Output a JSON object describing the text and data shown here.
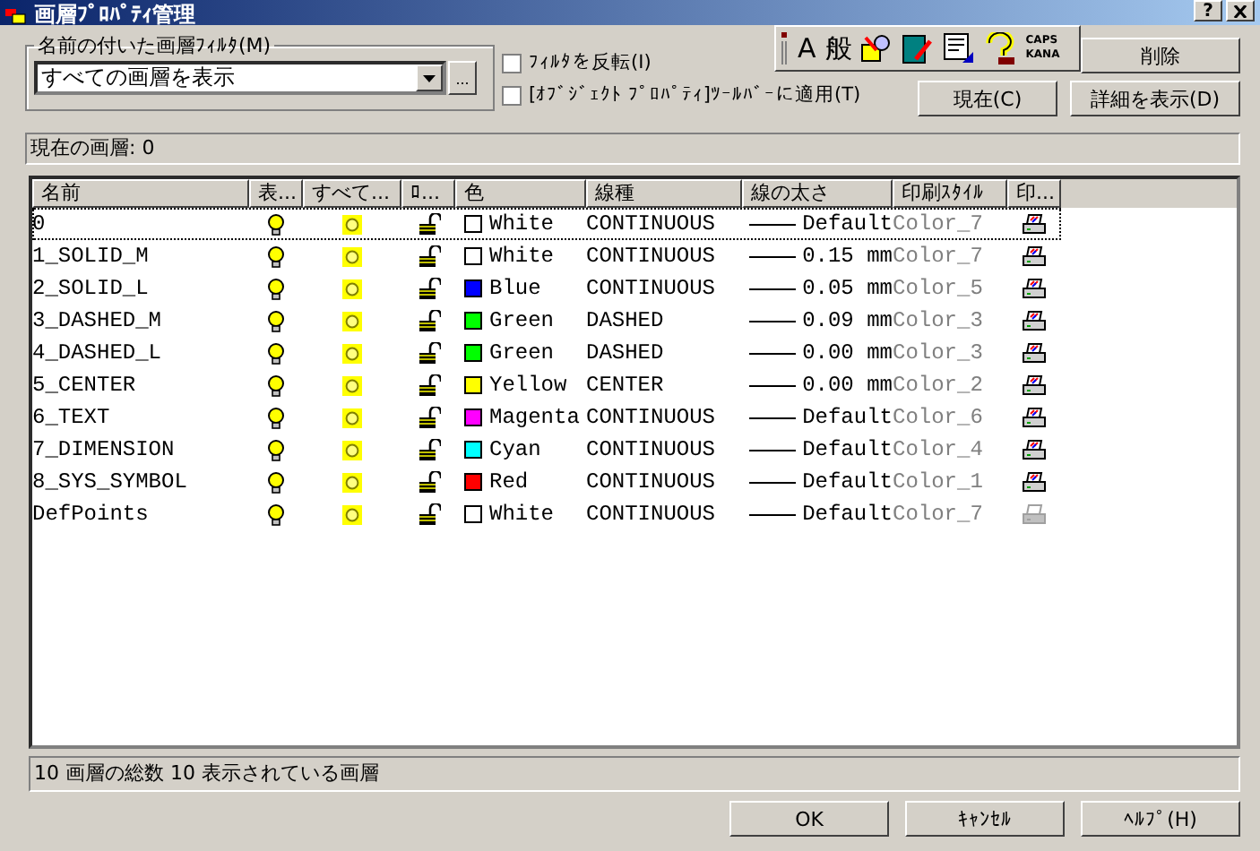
{
  "window": {
    "title": "画層ﾌﾟﾛﾊﾟﾃｨ管理",
    "help": "?"
  },
  "filter": {
    "legend": "名前の付いた画層ﾌｨﾙﾀ(M)",
    "value": "すべての画層を表示",
    "browse": "..."
  },
  "options": [
    {
      "label": "ﾌｨﾙﾀを反転(I)",
      "checked": false
    },
    {
      "label": "[ｵﾌﾞｼﾞｪｸﾄ ﾌﾟﾛﾊﾟﾃｨ]ﾂｰﾙﾊﾞｰに適用(T)",
      "checked": false
    }
  ],
  "ime_toolbar": {
    "glyphs": [
      "A",
      "般"
    ],
    "caps": "CAPS",
    "kana": "KANA"
  },
  "delete_button": "削除",
  "current_button": "現在(C)",
  "details_button": "詳細を表示(D)",
  "current_layer": "現在の画層:  0",
  "table": {
    "columns": [
      "名前",
      "表...",
      "すべて...",
      "ﾛ...",
      "色",
      "線種",
      "線の太さ",
      "印刷ｽﾀｲﾙ",
      "印..."
    ],
    "rows": [
      {
        "name": "0",
        "on": true,
        "frozen": false,
        "locked": false,
        "color": "#ffffff",
        "color_name": "White",
        "linetype": "CONTINUOUS",
        "lineweight": "Default",
        "plot_style": "Color_7",
        "plot": true,
        "selected": true
      },
      {
        "name": "1_SOLID_M",
        "on": true,
        "frozen": false,
        "locked": false,
        "color": "#ffffff",
        "color_name": "White",
        "linetype": "CONTINUOUS",
        "lineweight": "0.15 mm",
        "plot_style": "Color_7",
        "plot": true,
        "selected": false
      },
      {
        "name": "2_SOLID_L",
        "on": true,
        "frozen": false,
        "locked": false,
        "color": "#0000ff",
        "color_name": "Blue",
        "linetype": "CONTINUOUS",
        "lineweight": "0.05 mm",
        "plot_style": "Color_5",
        "plot": true,
        "selected": false
      },
      {
        "name": "3_DASHED_M",
        "on": true,
        "frozen": false,
        "locked": false,
        "color": "#00ff00",
        "color_name": "Green",
        "linetype": "DASHED",
        "lineweight": "0.09 mm",
        "plot_style": "Color_3",
        "plot": true,
        "selected": false
      },
      {
        "name": "4_DASHED_L",
        "on": true,
        "frozen": false,
        "locked": false,
        "color": "#00ff00",
        "color_name": "Green",
        "linetype": "DASHED",
        "lineweight": "0.00 mm",
        "plot_style": "Color_3",
        "plot": true,
        "selected": false
      },
      {
        "name": "5_CENTER",
        "on": true,
        "frozen": false,
        "locked": false,
        "color": "#ffff00",
        "color_name": "Yellow",
        "linetype": "CENTER",
        "lineweight": "0.00 mm",
        "plot_style": "Color_2",
        "plot": true,
        "selected": false
      },
      {
        "name": "6_TEXT",
        "on": true,
        "frozen": false,
        "locked": false,
        "color": "#ff00ff",
        "color_name": "Magenta",
        "linetype": "CONTINUOUS",
        "lineweight": "Default",
        "plot_style": "Color_6",
        "plot": true,
        "selected": false
      },
      {
        "name": "7_DIMENSION",
        "on": true,
        "frozen": false,
        "locked": false,
        "color": "#00ffff",
        "color_name": "Cyan",
        "linetype": "CONTINUOUS",
        "lineweight": "Default",
        "plot_style": "Color_4",
        "plot": true,
        "selected": false
      },
      {
        "name": "8_SYS_SYMBOL",
        "on": true,
        "frozen": false,
        "locked": false,
        "color": "#ff0000",
        "color_name": "Red",
        "linetype": "CONTINUOUS",
        "lineweight": "Default",
        "plot_style": "Color_1",
        "plot": true,
        "selected": false
      },
      {
        "name": "DefPoints",
        "on": true,
        "frozen": false,
        "locked": false,
        "color": "#ffffff",
        "color_name": "White",
        "linetype": "CONTINUOUS",
        "lineweight": "Default",
        "plot_style": "Color_7",
        "plot": false,
        "selected": false
      }
    ]
  },
  "status_bar": "10 画層の総数 10 表示されている画層",
  "buttons": [
    "OK",
    "ｷｬﾝｾﾙ",
    "ﾍﾙﾌﾟ(H)"
  ]
}
